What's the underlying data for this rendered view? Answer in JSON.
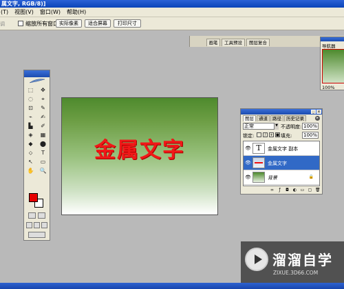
{
  "window": {
    "title": "属文字, RGB/8)]"
  },
  "menubar": {
    "items": [
      "(T)",
      "视图(V)",
      "窗口(W)",
      "帮助(H)"
    ]
  },
  "options": {
    "label": "调",
    "checkbox_label": "缩放所有窗口",
    "buttons": [
      "实际像素",
      "适合屏幕",
      "打印尺寸"
    ]
  },
  "palette_well": {
    "tabs": [
      "画笔",
      "工具预设",
      "图层复合"
    ]
  },
  "toolbox": {
    "tools": [
      "⬚",
      "✥",
      "◌",
      "⌖",
      "⊡",
      "✎",
      "⌁",
      "✍",
      "▙",
      "✐",
      "◈",
      "▦",
      "◆",
      "⬤",
      "⬦",
      "T",
      "↖",
      "▭",
      "✋",
      "🔍"
    ],
    "foreground_color": "#e60000",
    "background_color": "#ffffff"
  },
  "canvas": {
    "text": "金属文字",
    "text_color": "#f01818"
  },
  "navigator": {
    "tab": "导航器",
    "zoom": "100%"
  },
  "layers_panel": {
    "tabs": [
      "图层",
      "通道",
      "路径",
      "历史记录"
    ],
    "blend_mode": "正常",
    "opacity_label": "不透明度:",
    "opacity_value": "100%",
    "lock_label": "锁定:",
    "fill_label": "填充:",
    "fill_value": "100%",
    "layers": [
      {
        "name": "金属文字 副本",
        "thumb": "T"
      },
      {
        "name": "金属文字"
      },
      {
        "name": "背景"
      }
    ]
  },
  "watermark": {
    "title": "溜溜自学",
    "url": "ZIXUE.3D66.COM"
  }
}
